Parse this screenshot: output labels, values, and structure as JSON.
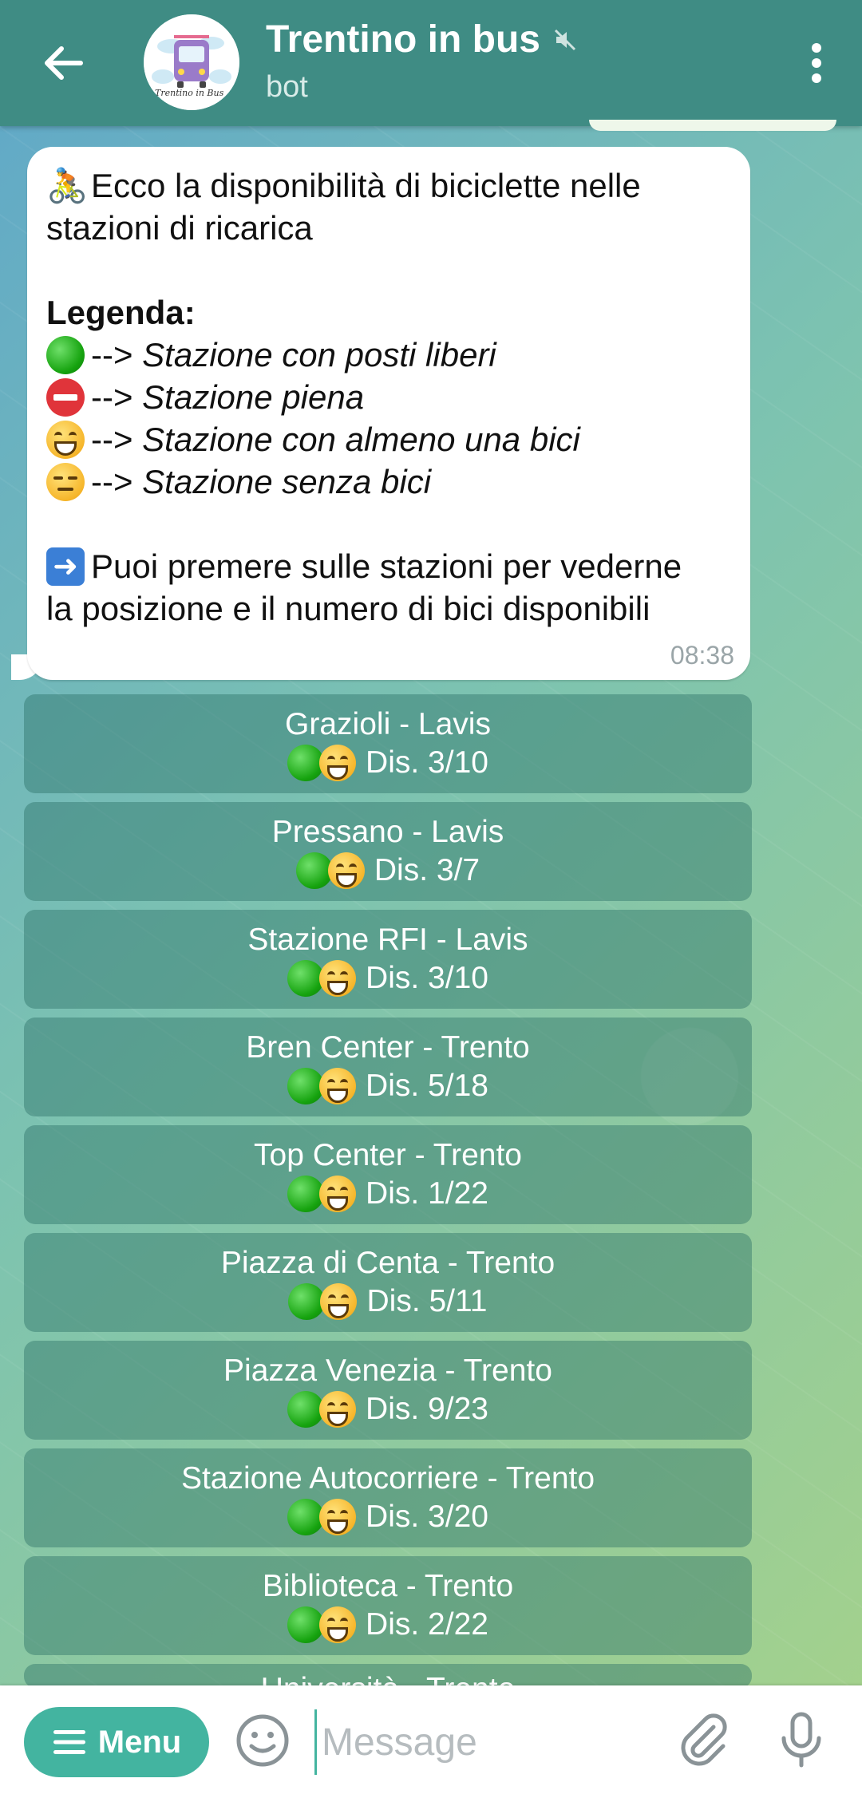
{
  "header": {
    "title": "Trentino in bus",
    "subtitle": "bot",
    "avatar_text": "Trentino in Bus",
    "muted_icon": "speaker-muted-icon"
  },
  "message": {
    "intro_line1": "Ecco la disponibilità di biciclette nelle",
    "intro_line2": "stazioni di ricarica",
    "legend_title": "Legenda:",
    "legend": [
      {
        "icon": "green-circle",
        "text": "Stazione con posti liberi"
      },
      {
        "icon": "no-entry",
        "text": "Stazione piena"
      },
      {
        "icon": "grinning-face",
        "text": "Stazione con almeno una bici"
      },
      {
        "icon": "expressionless-face",
        "text": "Stazione senza bici"
      }
    ],
    "arrow_prefix": "-->",
    "footer_line1": "Puoi premere sulle stazioni per vederne",
    "footer_line2": "la posizione e il numero di bici disponibili",
    "time": "08:38"
  },
  "stations": [
    {
      "name": "Grazioli - Lavis",
      "dis": "Dis.  3/10"
    },
    {
      "name": "Pressano - Lavis",
      "dis": "Dis.  3/7"
    },
    {
      "name": "Stazione RFI - Lavis",
      "dis": "Dis.  3/10"
    },
    {
      "name": "Bren Center - Trento",
      "dis": "Dis.  5/18"
    },
    {
      "name": "Top Center - Trento",
      "dis": "Dis.  1/22"
    },
    {
      "name": "Piazza di Centa - Trento",
      "dis": "Dis.  5/11"
    },
    {
      "name": "Piazza Venezia - Trento",
      "dis": "Dis.  9/23"
    },
    {
      "name": "Stazione Autocorriere - Trento",
      "dis": "Dis.  3/20"
    },
    {
      "name": "Biblioteca - Trento",
      "dis": "Dis.  2/22"
    },
    {
      "name": "Università - Trento",
      "dis": ""
    }
  ],
  "input": {
    "menu_label": "Menu",
    "placeholder": "Message"
  },
  "colors": {
    "header": "#3f8c84",
    "accent": "#43b4a0"
  }
}
